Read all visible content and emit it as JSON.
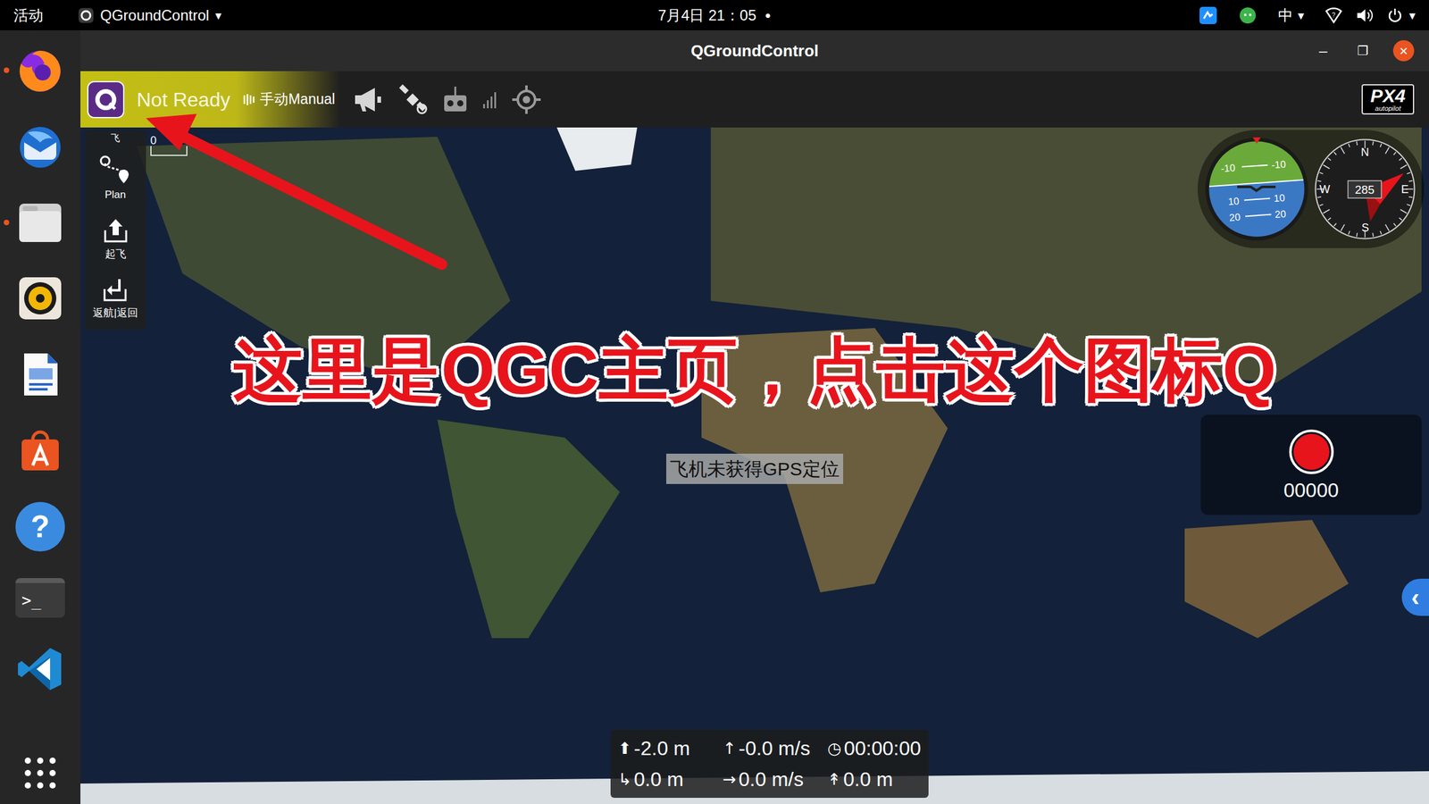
{
  "top_bar": {
    "activities": "活动",
    "app_menu": "QGroundControl",
    "app_menu_arrow": "▾",
    "clock": "7月4日 21：05",
    "clock_indicator": "●",
    "input_method": "中",
    "input_method_arrow": "▾",
    "power_arrow": "▾"
  },
  "dock": {
    "items": [
      {
        "kind": "firefox",
        "running": true
      },
      {
        "kind": "thunderbird",
        "running": false
      },
      {
        "kind": "files",
        "running": true
      },
      {
        "kind": "rhythmbox",
        "running": false
      },
      {
        "kind": "writer",
        "running": false
      },
      {
        "kind": "software",
        "running": false
      },
      {
        "kind": "help",
        "running": false,
        "glyph": "?"
      },
      {
        "kind": "terminal",
        "running": false,
        "glyph": ">_"
      },
      {
        "kind": "vscode",
        "running": false
      }
    ]
  },
  "window": {
    "title": "QGroundControl",
    "controls": [
      "–",
      "❐",
      "✕"
    ]
  },
  "toolbar": {
    "status": "Not Ready",
    "flight_mode": "手动Manual",
    "logo": {
      "brand": "PX4",
      "tagline": "autopilot"
    }
  },
  "tools": [
    {
      "kind": "fly",
      "label": "飞"
    },
    {
      "kind": "plan",
      "label": "Plan"
    },
    {
      "kind": "takeoff",
      "label": "起飞"
    },
    {
      "kind": "return",
      "label": "返航|返回"
    }
  ],
  "map": {
    "scale": "0",
    "gps_message": "飞机未获得GPS定位"
  },
  "attitude": {
    "pitch_labels": [
      "-10",
      "-10",
      "10",
      "10",
      "20",
      "20"
    ]
  },
  "compass": {
    "heading": "285",
    "north": "N",
    "east": "E",
    "south": "S",
    "west": "W"
  },
  "recorder": {
    "count": "00000",
    "recording": false
  },
  "side_tab": {
    "glyph": "‹"
  },
  "telemetry": [
    {
      "icon": "⬆",
      "value": "-2.0 m"
    },
    {
      "icon": "↑",
      "value": "-0.0 m/s"
    },
    {
      "icon": "◷",
      "value": "00:00:00"
    },
    {
      "icon": "↳",
      "value": "0.0 m"
    },
    {
      "icon": "→",
      "value": "0.0 m/s"
    },
    {
      "icon": "↟",
      "value": "0.0 m"
    }
  ],
  "annotation": {
    "text": "这里是QGC主页，点击这个图标Q"
  }
}
